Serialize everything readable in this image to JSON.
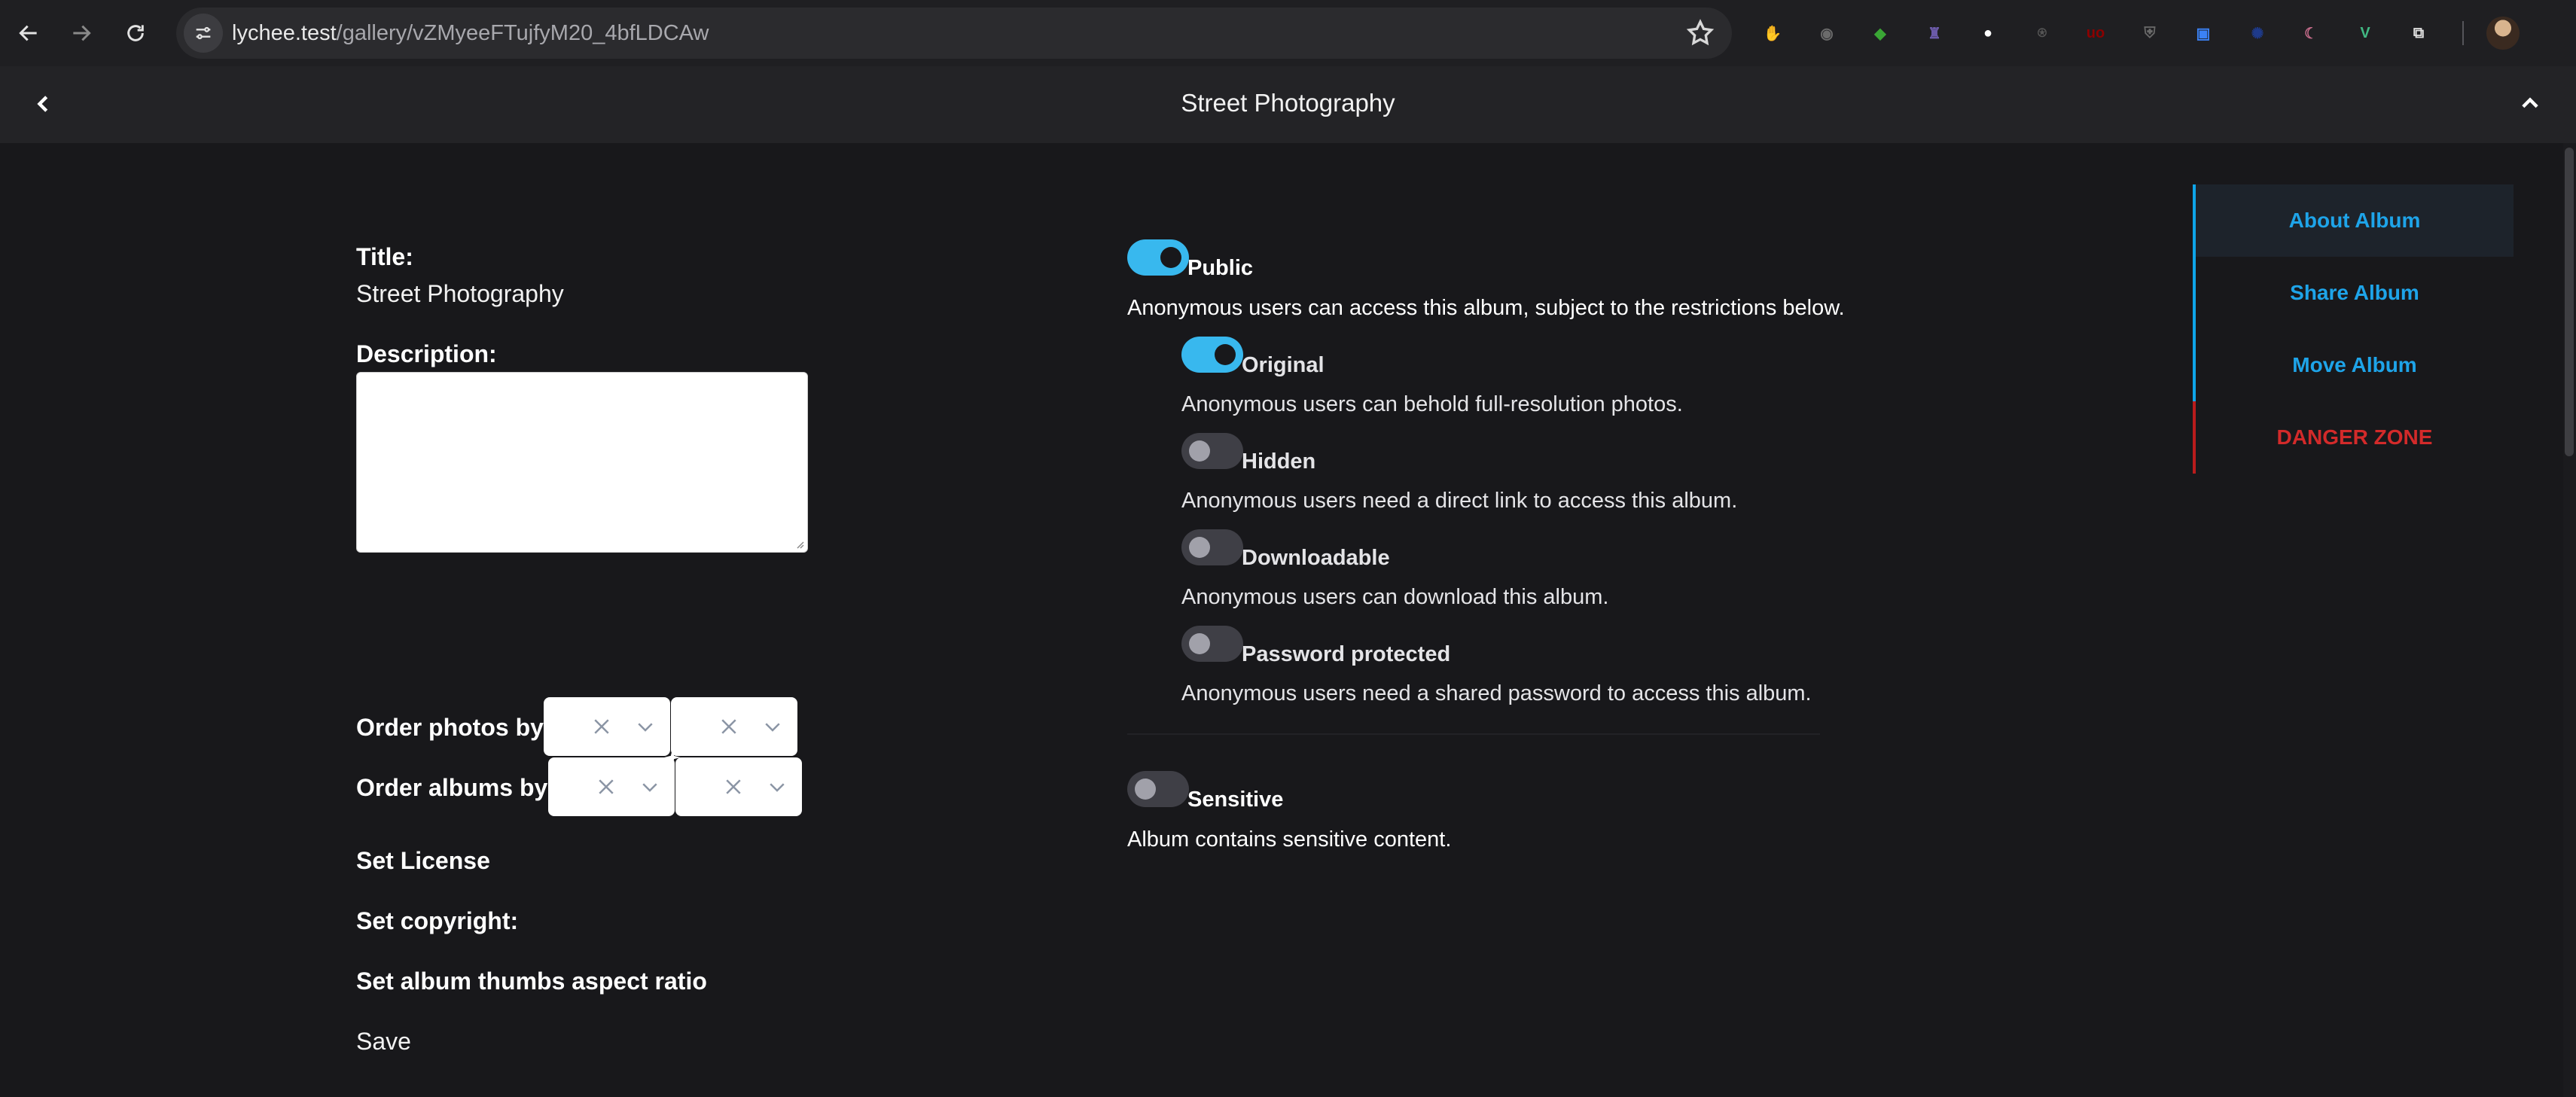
{
  "browser": {
    "url_host": "lychee.test",
    "url_path": "/gallery/vZMyeeFTujfyM20_4bfLDCAw",
    "extensions": [
      {
        "name": "red-hand-extension-icon",
        "color": "#d21f1f",
        "glyph": "✋"
      },
      {
        "name": "eyes-extension-icon",
        "color": "#6b6b6b",
        "glyph": "◉"
      },
      {
        "name": "green-extension-icon",
        "color": "#3aa635",
        "glyph": "◆"
      },
      {
        "name": "purple-extension-icon",
        "color": "#6b5aa8",
        "glyph": "♜"
      },
      {
        "name": "red-dot-extension-icon",
        "color": "#ffffff",
        "glyph": "●"
      },
      {
        "name": "joystick-extension-icon",
        "color": "#555555",
        "glyph": "⍟"
      },
      {
        "name": "ublock-extension-icon",
        "color": "#8b0000",
        "glyph": "uo"
      },
      {
        "name": "shield-extension-icon",
        "color": "#6a6a6a",
        "glyph": "⛨"
      },
      {
        "name": "blue-square-extension-icon",
        "color": "#3b82f6",
        "glyph": "▣"
      },
      {
        "name": "eu-extension-icon",
        "color": "#1e3a8a",
        "glyph": "✺"
      },
      {
        "name": "pink-extension-icon",
        "color": "#c46b8a",
        "glyph": "☾"
      },
      {
        "name": "vue-extension-icon",
        "color": "#41b883",
        "glyph": "V"
      },
      {
        "name": "puzzle-extension-icon",
        "color": "#e3e3e3",
        "glyph": "⧉"
      }
    ]
  },
  "header": {
    "title": "Street Photography"
  },
  "details": {
    "title_label": "Title:",
    "title_value": "Street Photography",
    "description_label": "Description:",
    "description_value": "",
    "order_photos_label": "Order photos by",
    "order_albums_label": "Order albums by",
    "license_label": "Set License",
    "copyright_label": "Set copyright:",
    "aspect_label": "Set album thumbs aspect ratio",
    "save_label": "Save"
  },
  "visibility": {
    "public": {
      "title": "Public",
      "desc": "Anonymous users can access this album, subject to the restrictions below.",
      "on": true
    },
    "options": [
      {
        "key": "original",
        "title": "Original",
        "desc": "Anonymous users can behold full-resolution photos.",
        "on": true
      },
      {
        "key": "hidden",
        "title": "Hidden",
        "desc": "Anonymous users need a direct link to access this album.",
        "on": false
      },
      {
        "key": "downloadable",
        "title": "Downloadable",
        "desc": "Anonymous users can download this album.",
        "on": false
      },
      {
        "key": "password",
        "title": "Password protected",
        "desc": "Anonymous users need a shared password to access this album.",
        "on": false
      }
    ],
    "sensitive": {
      "title": "Sensitive",
      "desc": "Album contains sensitive content.",
      "on": false
    }
  },
  "side_nav": {
    "items": [
      {
        "label": "About Album",
        "active": true
      },
      {
        "label": "Share Album",
        "active": false
      },
      {
        "label": "Move Album",
        "active": false
      },
      {
        "label": "DANGER ZONE",
        "active": false
      }
    ]
  },
  "colors": {
    "accent": "#38b8ee",
    "link": "#1ea4e9",
    "danger": "#d32a2a",
    "background": "#18181b"
  }
}
